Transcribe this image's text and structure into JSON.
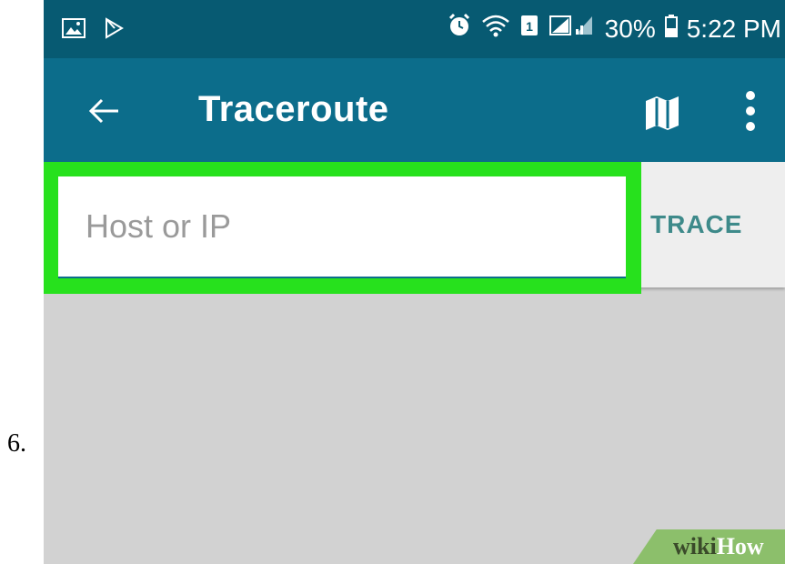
{
  "step": {
    "number": "6."
  },
  "status_bar": {
    "battery": "30%",
    "time": "5:22 PM",
    "left_icons": [
      "image-icon",
      "play-store-icon"
    ],
    "right_icons": [
      "alarm-icon",
      "wifi-icon",
      "sim-icon",
      "signal-icon",
      "battery-icon"
    ]
  },
  "toolbar": {
    "title": "Traceroute",
    "back_icon": "arrow-left-icon",
    "map_icon": "map-icon",
    "more_icon": "more-vert-icon"
  },
  "host_input": {
    "value": "",
    "placeholder": "Host or IP"
  },
  "trace_button": {
    "label": "TRACE"
  },
  "watermark": {
    "wiki": "wiki",
    "how": "How"
  },
  "colors": {
    "status_bar": "#075a72",
    "toolbar": "#0c6d8b",
    "highlight": "#27e11d",
    "content_bg": "#d2d2d2",
    "trace_text": "#3e8a8a"
  }
}
